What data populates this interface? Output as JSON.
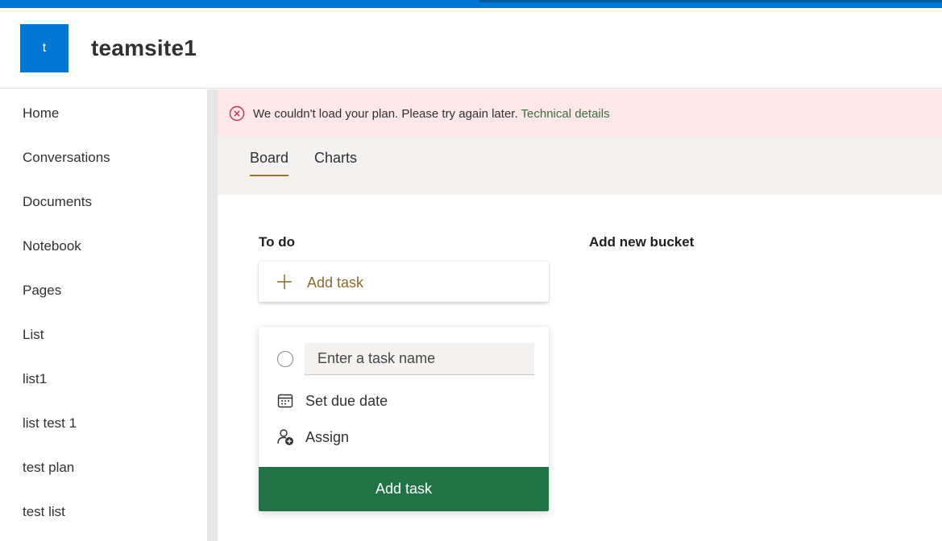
{
  "site": {
    "logo_letter": "t",
    "title": "teamsite1"
  },
  "sidebar": {
    "items": [
      {
        "label": "Home"
      },
      {
        "label": "Conversations"
      },
      {
        "label": "Documents"
      },
      {
        "label": "Notebook"
      },
      {
        "label": "Pages"
      },
      {
        "label": "List"
      },
      {
        "label": "list1"
      },
      {
        "label": "list test 1"
      },
      {
        "label": "test plan"
      },
      {
        "label": "test list"
      }
    ]
  },
  "error": {
    "message": "We couldn't load your plan. Please try again later.",
    "link": "Technical details"
  },
  "tabs": [
    {
      "label": "Board",
      "active": true
    },
    {
      "label": "Charts",
      "active": false
    }
  ],
  "board": {
    "bucket_title": "To do",
    "add_bucket_label": "Add new bucket",
    "add_task_label": "Add task",
    "new_task": {
      "name_placeholder": "Enter a task name",
      "due_date_label": "Set due date",
      "assign_label": "Assign",
      "submit_label": "Add task"
    }
  },
  "colors": {
    "brand": "#0078d4",
    "error_bg": "#fde7e9",
    "error_icon": "#c4314b",
    "link": "#3a6f3a",
    "accent_gold": "#8a6a2e",
    "submit_green": "#217346"
  },
  "icons": {
    "error": "error-circle-icon",
    "add": "plus-icon",
    "radio": "radio-circle-icon",
    "due_date": "calendar-icon",
    "assign": "add-person-icon"
  }
}
